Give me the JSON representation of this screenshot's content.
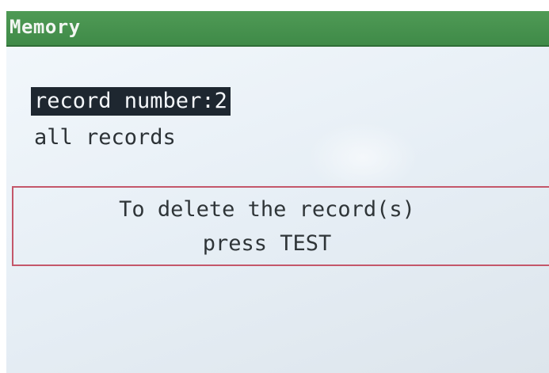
{
  "title_bar": {
    "title": "Memory"
  },
  "menu": {
    "items": [
      {
        "label": "record number:2",
        "selected": true
      },
      {
        "label": "all records",
        "selected": false
      }
    ]
  },
  "notice": {
    "lines": [
      "To delete the record(s)",
      "press TEST"
    ]
  },
  "colors": {
    "title_bar": "#3f8a48",
    "notice_border": "#c4576a",
    "selection_background": "#1e2730",
    "screen_background": "#e6eef5"
  }
}
